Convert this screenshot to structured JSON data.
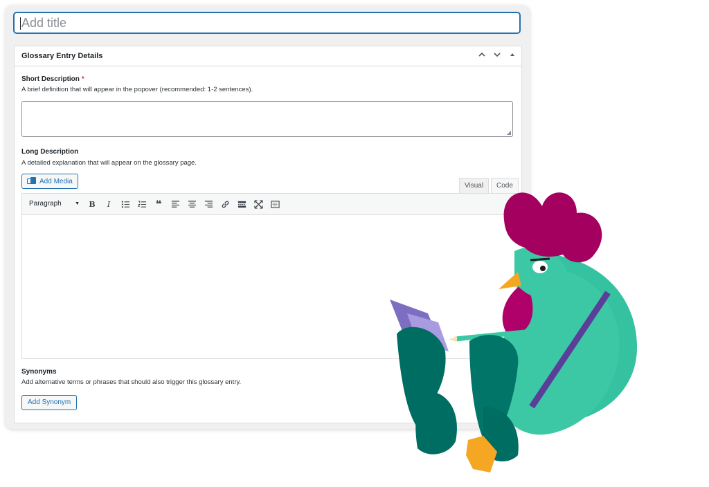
{
  "title_field": {
    "placeholder": "Add title"
  },
  "metabox": {
    "title": "Glossary Entry Details",
    "controls": [
      "chevron-up",
      "chevron-down",
      "collapse"
    ]
  },
  "short_description": {
    "label": "Short Description",
    "required_marker": "*",
    "description": "A brief definition that will appear in the popover (recommended: 1-2 sentences).",
    "value": ""
  },
  "long_description": {
    "label": "Long Description",
    "description": "A detailed explanation that will appear on the glossary page.",
    "add_media_label": "Add Media",
    "tabs": {
      "visual": "Visual",
      "code": "Code"
    },
    "format_select": "Paragraph",
    "toolbar_icons": [
      "bold-icon",
      "italic-icon",
      "bullet-list-icon",
      "numbered-list-icon",
      "blockquote-icon",
      "align-left-icon",
      "align-center-icon",
      "align-right-icon",
      "link-icon",
      "read-more-icon",
      "fullscreen-icon",
      "toolbar-toggle-icon"
    ],
    "content": ""
  },
  "synonyms": {
    "label": "Synonyms",
    "description": "Add alternative terms or phrases that should also trigger this glossary entry.",
    "button_label": "Add Synonym"
  },
  "colors": {
    "accent": "#2271b1",
    "rooster_comb": "#a3005f",
    "rooster_body_dark": "#006d62",
    "rooster_body_light": "#35c2a0",
    "rooster_beak": "#f5a623",
    "book": "#7d6ec2"
  }
}
